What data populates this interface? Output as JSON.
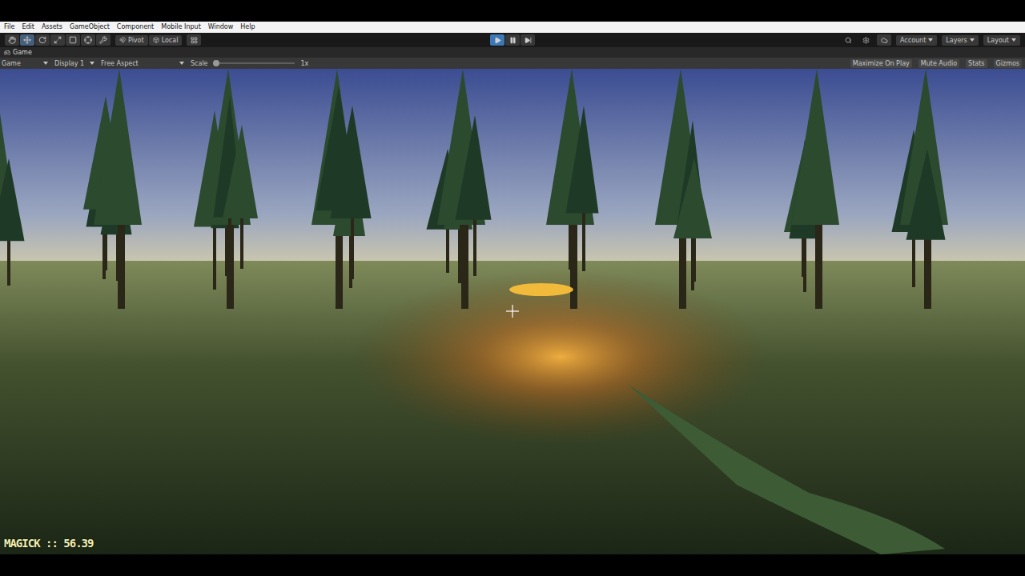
{
  "window": {
    "title": "Game"
  },
  "menu": [
    "File",
    "Edit",
    "Assets",
    "GameObject",
    "Component",
    "Mobile Input",
    "Window",
    "Help"
  ],
  "tools": [
    {
      "kind": "hand",
      "selected": false
    },
    {
      "kind": "move",
      "selected": true
    },
    {
      "kind": "rotate",
      "selected": false
    },
    {
      "kind": "scale",
      "selected": false
    },
    {
      "kind": "rect",
      "selected": false
    },
    {
      "kind": "transform",
      "selected": false
    },
    {
      "kind": "custom",
      "selected": false
    }
  ],
  "handles": [
    {
      "label": "Pivot",
      "kind": "pivot"
    },
    {
      "label": "Local",
      "kind": "local"
    }
  ],
  "playback": [
    {
      "kind": "play",
      "selected": true
    },
    {
      "kind": "pause",
      "selected": false
    },
    {
      "kind": "step",
      "selected": false
    }
  ],
  "account_menus": [
    "Account",
    "Layers",
    "Layout"
  ],
  "game_bar": {
    "view": "Game",
    "display": "Display 1",
    "aspect": "Free Aspect",
    "scale": {
      "label": "Scale",
      "value": "1x",
      "level": 0.0
    },
    "toggles": [
      {
        "label": "Maximize On Play",
        "on": false
      },
      {
        "label": "Mute Audio",
        "on": false
      },
      {
        "label": "Stats",
        "on": false
      },
      {
        "label": "Gizmos",
        "on": false
      }
    ]
  },
  "hud": {
    "text": "MAGICK :: 56.39"
  }
}
